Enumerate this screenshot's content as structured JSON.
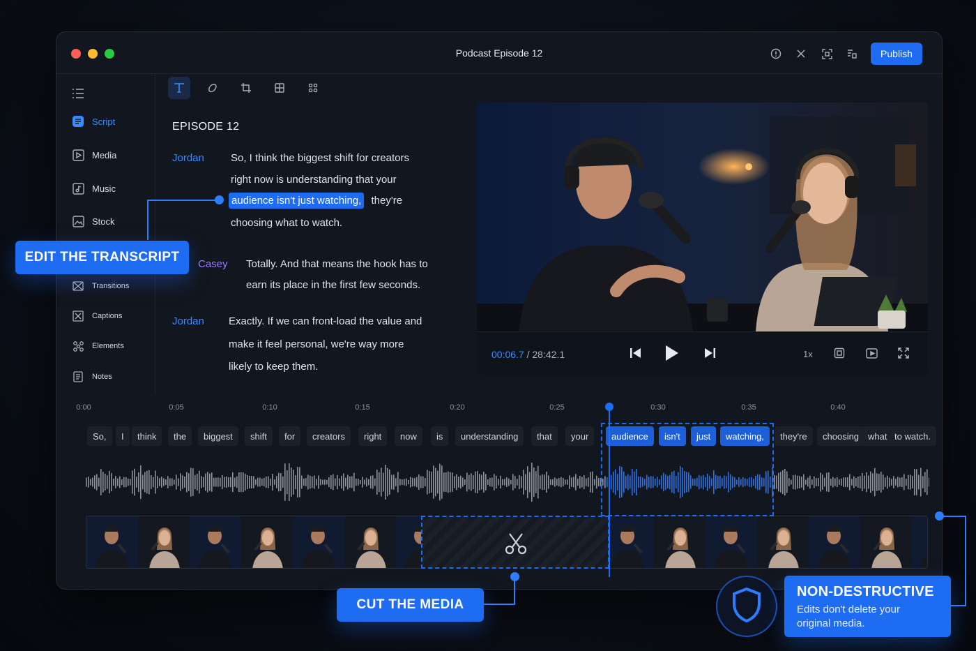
{
  "window": {
    "title": "Podcast Episode 12",
    "publish_label": "Publish"
  },
  "titlebar_icons": [
    "info-icon",
    "close-x-icon",
    "fit-screen-icon",
    "layers-icon"
  ],
  "sidebar": {
    "items": [
      {
        "label": "Script",
        "icon": "script-icon"
      },
      {
        "label": "Media",
        "icon": "media-icon"
      },
      {
        "label": "Music",
        "icon": "music-icon"
      },
      {
        "label": "Stock",
        "icon": "stock-icon"
      },
      {
        "label": "Transitions",
        "icon": "transitions-icon"
      },
      {
        "label": "Captions",
        "icon": "captions-icon"
      },
      {
        "label": "Elements",
        "icon": "elements-icon"
      },
      {
        "label": "Notes",
        "icon": "notes-icon"
      }
    ]
  },
  "toolbar": [
    "text-tool-icon",
    "shape-tool-icon",
    "crop-tool-icon",
    "layout-tool-icon",
    "grid-tool-icon"
  ],
  "transcript": {
    "title": "EPISODE 12",
    "blocks": [
      {
        "speaker": "Jordan",
        "lines": [
          "So, I think the biggest shift for creators",
          "right now is understanding that your",
          "audience isn't just watching,",
          "they're",
          "choosing what to watch."
        ]
      },
      {
        "speaker": "Casey",
        "lines": [
          "Totally. And that means the hook has to",
          "earn its place in the first few seconds."
        ]
      },
      {
        "speaker": "Jordan",
        "lines": [
          "Exactly. If we can front-load the value and",
          "make it feel personal, we're way more",
          "likely to keep them."
        ]
      }
    ]
  },
  "player": {
    "current": "00:06.7",
    "separator": "/",
    "total": "28:42.1",
    "speed": "1x"
  },
  "timeline": {
    "ticks": [
      "0:00",
      "0:05",
      "0:10",
      "0:15",
      "0:20",
      "0:25",
      "0:30",
      "0:35",
      "0:40"
    ],
    "words": [
      "So,",
      "I",
      "think",
      "the",
      "biggest",
      "shift",
      "for",
      "creators",
      "right",
      "now",
      "is",
      "understanding",
      "that",
      "your",
      "audience",
      "isn't",
      "just",
      "watching,",
      "they're",
      "choosing",
      "what",
      "to watch."
    ],
    "selected_words": [
      "audience",
      "isn't",
      "just",
      "watching,"
    ]
  },
  "callouts": {
    "edit": "EDIT THE TRANSCRIPT",
    "cut": "CUT THE MEDIA",
    "nd_title": "NON-DESTRUCTIVE",
    "nd_desc_1": "Edits don't delete your",
    "nd_desc_2": "original media."
  },
  "colors": {
    "accent": "#1d6cf2",
    "speaker_casey": "#9d7dff",
    "background": "#12161e"
  }
}
